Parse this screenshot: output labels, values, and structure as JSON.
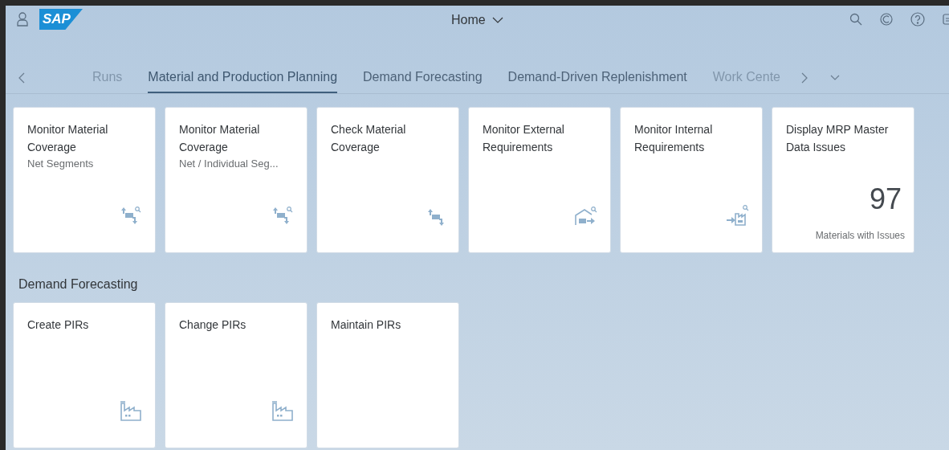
{
  "shell": {
    "logo": "SAP",
    "title": "Home"
  },
  "tabs": [
    {
      "label": "Runs",
      "selected": false,
      "faded": true
    },
    {
      "label": "Material and Production Planning",
      "selected": true,
      "faded": false
    },
    {
      "label": "Demand Forecasting",
      "selected": false,
      "faded": false
    },
    {
      "label": "Demand-Driven Replenishment",
      "selected": false,
      "faded": false
    },
    {
      "label": "Work Cente",
      "selected": false,
      "faded": true
    }
  ],
  "groups": [
    {
      "tiles": [
        {
          "kind": "launch",
          "title": "Monitor Material Coverage",
          "subtitle": "Net Segments",
          "icon": {
            "kind": "coverage_search"
          }
        },
        {
          "kind": "launch",
          "title": "Monitor Material Coverage",
          "subtitle": "Net / Individual Seg...",
          "icon": {
            "kind": "coverage_search"
          }
        },
        {
          "kind": "launch",
          "title": "Check Material Coverage",
          "icon": {
            "kind": "coverage"
          }
        },
        {
          "kind": "launch",
          "title": "Monitor External Requirements",
          "icon": {
            "kind": "warehouse"
          }
        },
        {
          "kind": "launch",
          "title": "Monitor Internal Requirements",
          "icon": {
            "kind": "factory_search"
          }
        },
        {
          "kind": "numeric",
          "title": "Display MRP Master Data Issues",
          "value": "97",
          "footer": "Materials with Issues"
        }
      ]
    },
    {
      "title": "Demand Forecasting",
      "tiles": [
        {
          "kind": "launch",
          "title": "Create PIRs",
          "icon": {
            "kind": "factory"
          }
        },
        {
          "kind": "launch",
          "title": "Change PIRs",
          "icon": {
            "kind": "factory"
          }
        },
        {
          "kind": "launch",
          "title": "Maintain PIRs"
        }
      ]
    }
  ]
}
